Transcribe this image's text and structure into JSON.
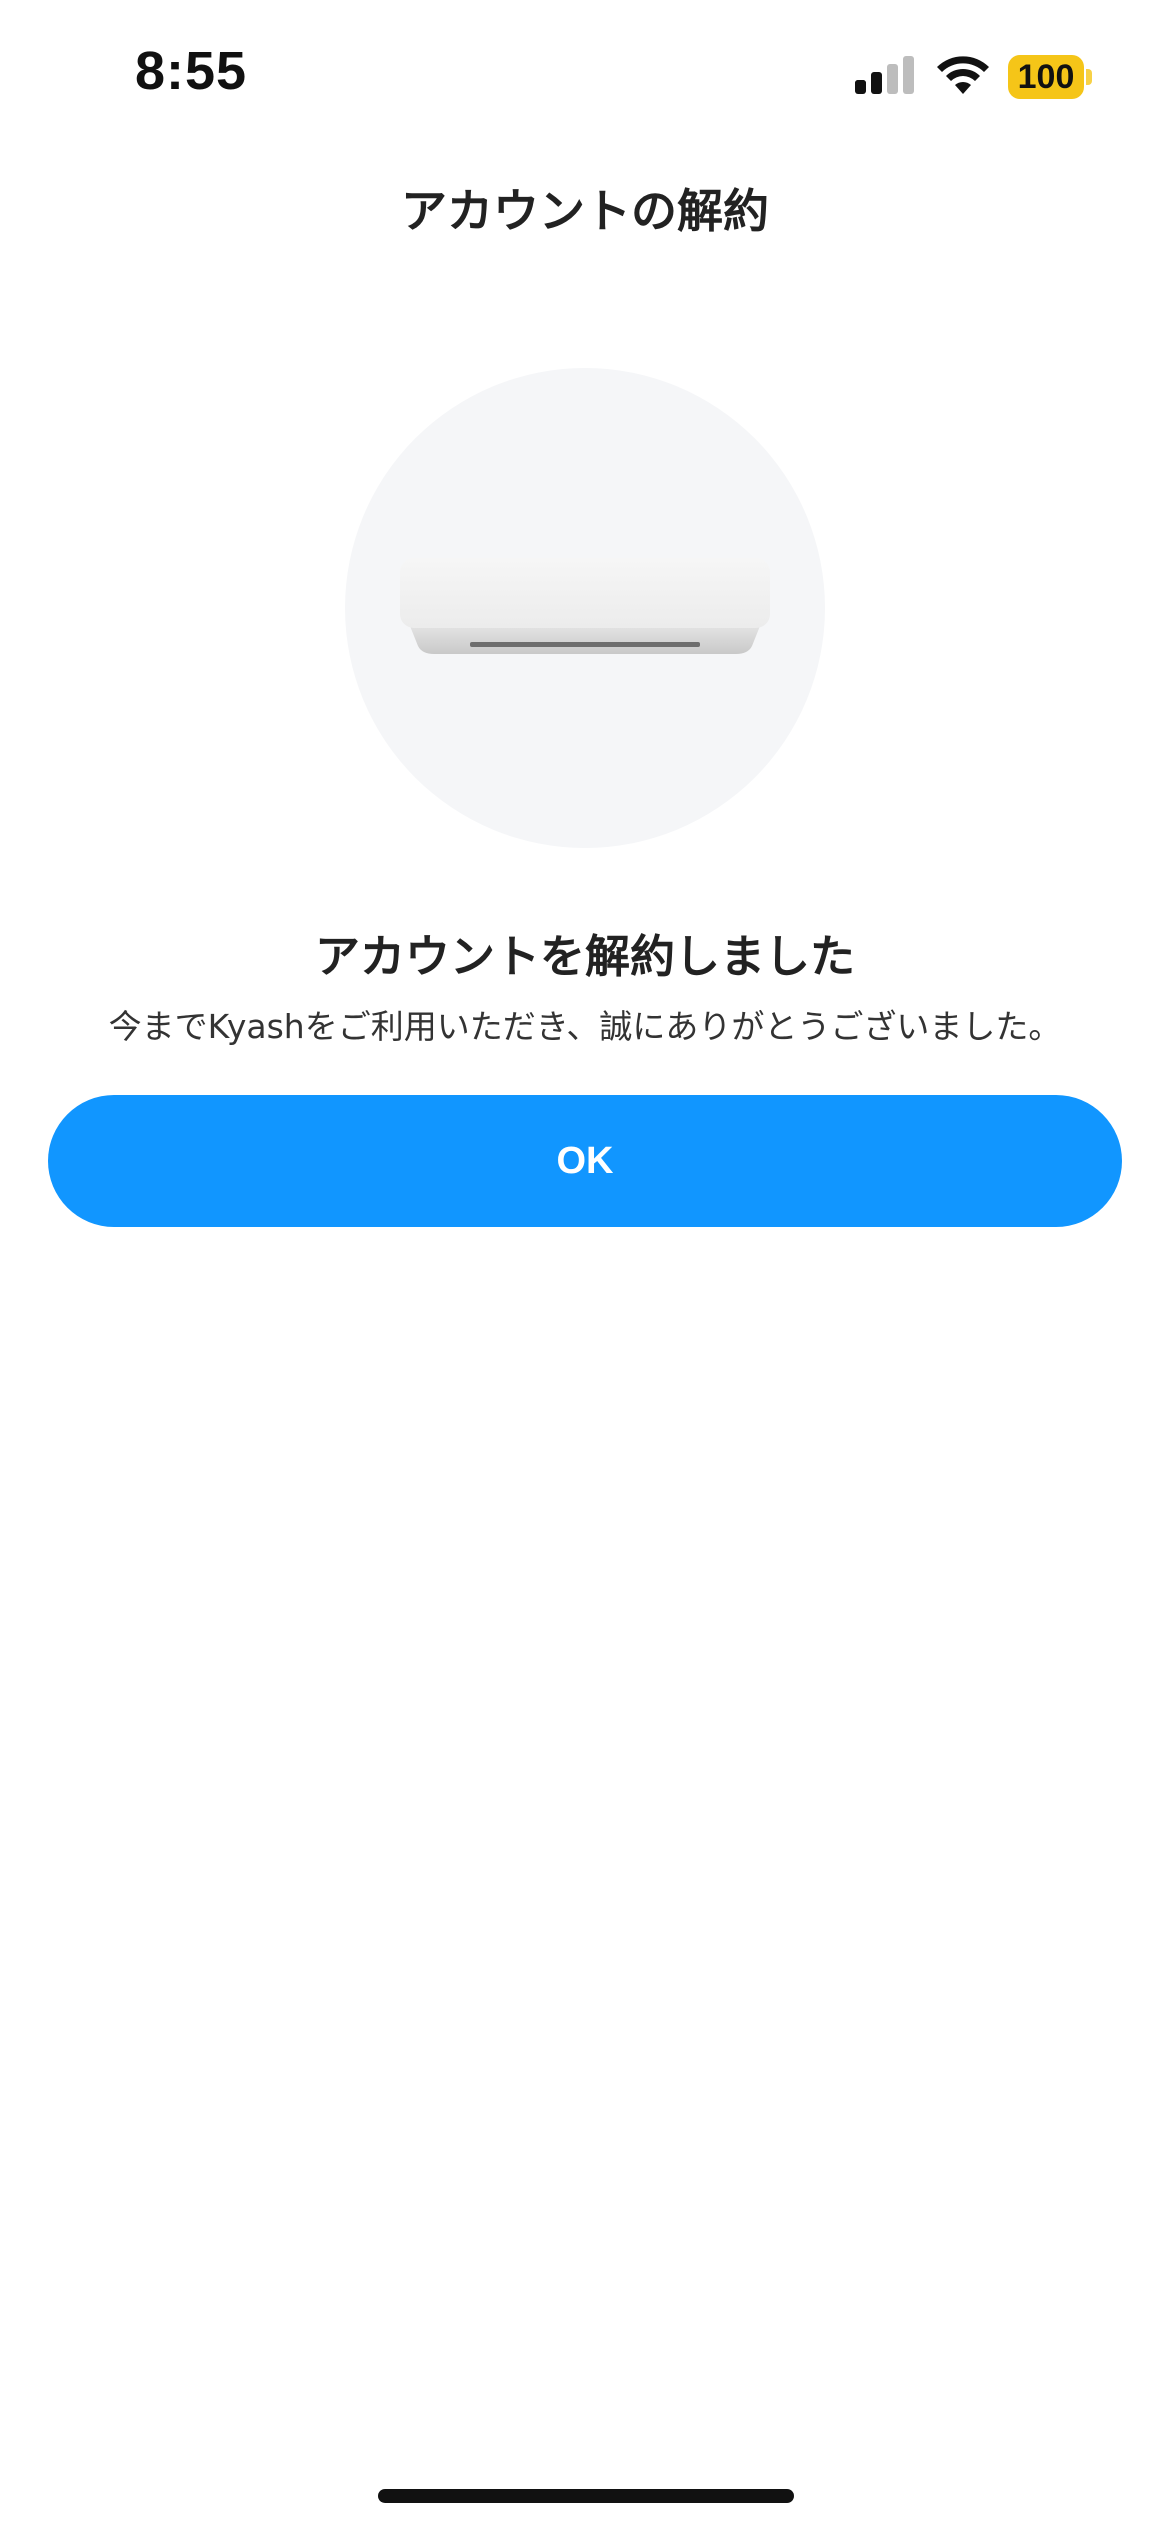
{
  "status_bar": {
    "time": "8:55",
    "battery_level": "100",
    "icons": [
      "cellular-signal-icon",
      "wifi-icon",
      "battery-icon"
    ],
    "battery_color": "#f5c518"
  },
  "header": {
    "title": "アカウントの解約"
  },
  "illustration": {
    "icon": "air-conditioner-icon"
  },
  "message": {
    "title": "アカウントを解約しました",
    "body": "今までKyashをご利用いただき、誠にありがとうございました。"
  },
  "actions": {
    "ok_label": "OK"
  },
  "colors": {
    "accent": "#1196ff",
    "background": "#ffffff",
    "illustration_bg": "#f5f6f8"
  }
}
